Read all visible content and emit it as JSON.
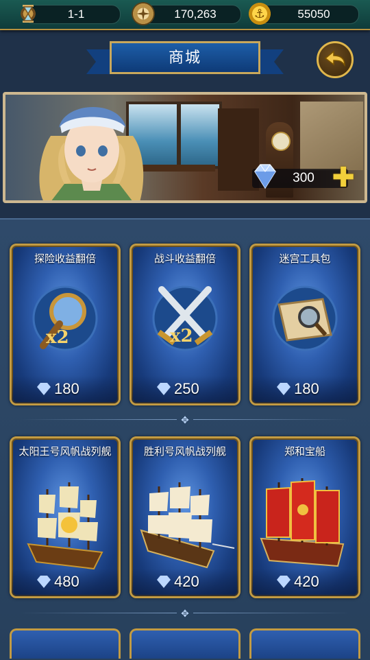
{
  "topbar": {
    "stage": {
      "icon": "hourglass-icon",
      "value": "1-1"
    },
    "gold": {
      "icon": "compass-coin-icon",
      "value": "170,263"
    },
    "coins": {
      "icon": "anchor-coin-icon",
      "value": "55050"
    }
  },
  "title": "商城",
  "back_icon": "back-arrow-icon",
  "banner": {
    "diamond_icon": "diamond-icon",
    "diamond_count": "300",
    "add_icon": "plus-icon"
  },
  "shop": {
    "rows": [
      [
        {
          "name": "探险收益翻倍",
          "art": "magnifier-x2",
          "badge": "x2",
          "price": "180"
        },
        {
          "name": "战斗收益翻倍",
          "art": "crossed-swords-x2",
          "badge": "x2",
          "price": "250"
        },
        {
          "name": "迷宫工具包",
          "art": "map-scroll",
          "price": "180"
        }
      ],
      [
        {
          "name": "太阳王号风帆战列舰",
          "art": "sun-king-ship",
          "price": "480"
        },
        {
          "name": "胜利号风帆战列舰",
          "art": "victory-ship",
          "price": "420"
        },
        {
          "name": "郑和宝船",
          "art": "treasure-junk",
          "price": "420"
        }
      ]
    ]
  },
  "colors": {
    "card_border": "#c39b42",
    "card_blue": "#2f5fb0",
    "title_blue": "#1d5ea8",
    "gold": "#f2d03b"
  }
}
